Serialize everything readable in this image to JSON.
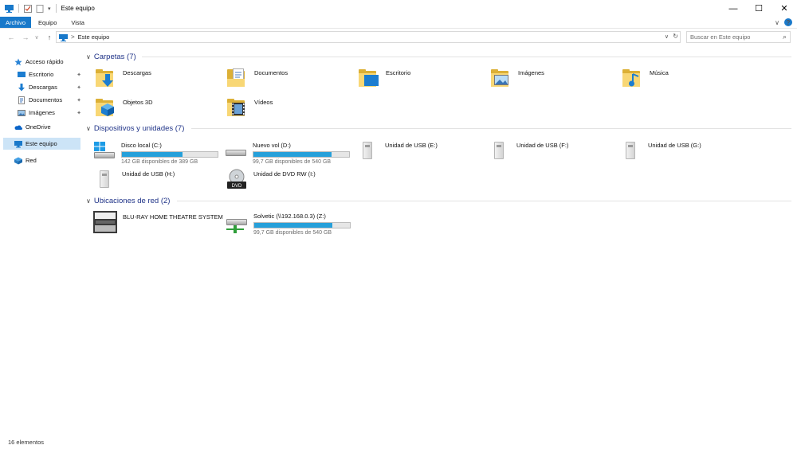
{
  "window": {
    "title": "Este equipo",
    "minimize": "—",
    "maximize": "☐",
    "close": "✕"
  },
  "ribbon": {
    "tabs": [
      "Archivo",
      "Equipo",
      "Vista"
    ],
    "chevron": "∨",
    "help": "?"
  },
  "address": {
    "back": "←",
    "forward": "→",
    "recent": "∨",
    "up": "↑",
    "separator": ">",
    "path": "Este equipo",
    "dropdown": "∨",
    "refresh": "↻",
    "search_placeholder": "Buscar en Este equipo",
    "search_icon": "⌕"
  },
  "sidebar": {
    "items": [
      {
        "label": "Acceso rápido",
        "icon": "star-icon"
      },
      {
        "label": "Escritorio",
        "icon": "desktop-icon",
        "pinned": true
      },
      {
        "label": "Descargas",
        "icon": "download-arrow-icon",
        "pinned": true
      },
      {
        "label": "Documentos",
        "icon": "document-icon",
        "pinned": true
      },
      {
        "label": "Imágenes",
        "icon": "picture-icon",
        "pinned": true
      },
      {
        "label": "OneDrive",
        "icon": "cloud-icon"
      },
      {
        "label": "Este equipo",
        "icon": "computer-icon",
        "selected": true
      },
      {
        "label": "Red",
        "icon": "network-icon"
      }
    ],
    "pin_glyph": "📌"
  },
  "groups": {
    "folders": {
      "title": "Carpetas (7)",
      "items": [
        "Descargas",
        "Documentos",
        "Escritorio",
        "Imágenes",
        "Música",
        "Objetos 3D",
        "Vídeos"
      ]
    },
    "devices": {
      "title": "Dispositivos y unidades (7)",
      "items": [
        {
          "name": "Disco local (C:)",
          "free": "142 GB disponibles de 389 GB",
          "used_fraction": 0.63
        },
        {
          "name": "Nuevo vol (D:)",
          "free": "99,7 GB disponibles de 540 GB",
          "used_fraction": 0.82
        },
        {
          "name": "Unidad de USB (E:)"
        },
        {
          "name": "Unidad de USB (F:)"
        },
        {
          "name": "Unidad de USB (G:)"
        },
        {
          "name": "Unidad de USB (H:)"
        },
        {
          "name": "Unidad de DVD RW (I:)",
          "icon_label": "DVD"
        }
      ]
    },
    "network": {
      "title": "Ubicaciones de red (2)",
      "items": [
        {
          "name": "BLU-RAY HOME THEATRE SYSTEM"
        },
        {
          "name": "Solvetic (\\\\192.168.0.3) (Z:)",
          "free": "99,7 GB disponibles de 540 GB",
          "used_fraction": 0.82
        }
      ]
    }
  },
  "status": {
    "count": "16 elementos"
  },
  "colors": {
    "accent": "#1979ca",
    "selection": "#cce4f7",
    "bar_fill": "#26a0da",
    "group_title": "#1e3287"
  }
}
